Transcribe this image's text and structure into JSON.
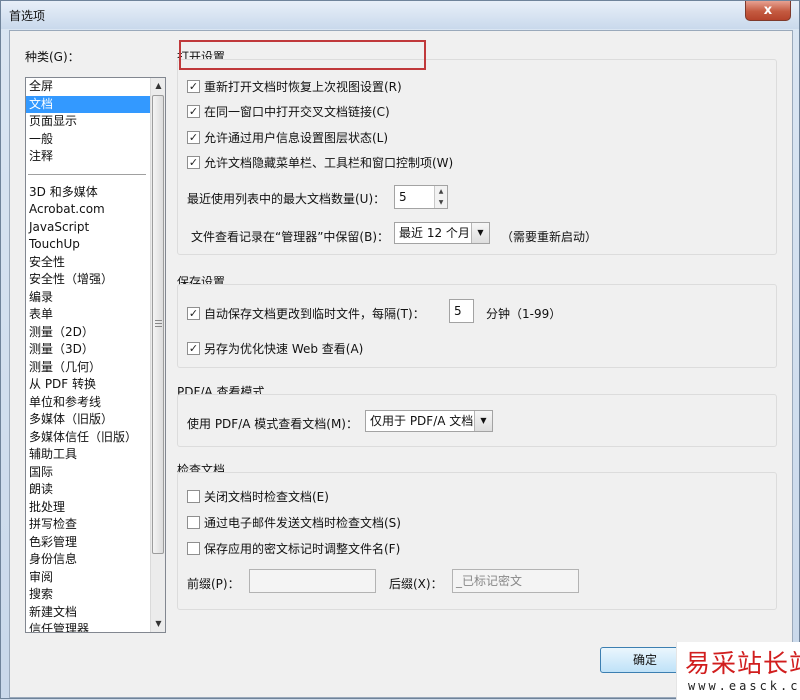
{
  "window": {
    "title": "首选项",
    "close_symbol": "x"
  },
  "sidebar": {
    "label": "种类(G)：",
    "group1": [
      {
        "label": "全屏",
        "selected": false
      },
      {
        "label": "文档",
        "selected": true
      },
      {
        "label": "页面显示",
        "selected": false
      },
      {
        "label": "一般",
        "selected": false
      },
      {
        "label": "注释",
        "selected": false
      }
    ],
    "group2": [
      "3D 和多媒体",
      "Acrobat.com",
      "JavaScript",
      "TouchUp",
      "安全性",
      "安全性（增强）",
      "编录",
      "表单",
      "测量（2D）",
      "测量（3D）",
      "测量（几何）",
      "从 PDF 转换",
      "单位和参考线",
      "多媒体（旧版）",
      "多媒体信任（旧版）",
      "辅助工具",
      "国际",
      "朗读",
      "批处理",
      "拼写检查",
      "色彩管理",
      "身份信息",
      "审阅",
      "搜索",
      "新建文档",
      "信任管理器"
    ]
  },
  "open_settings": {
    "title": "打开设置",
    "options": [
      {
        "label": "重新打开文档时恢复上次视图设置(R)",
        "checked": true
      },
      {
        "label": "在同一窗口中打开交叉文档链接(C)",
        "checked": true
      },
      {
        "label": "允许通过用户信息设置图层状态(L)",
        "checked": true
      },
      {
        "label": "允许文档隐藏菜单栏、工具栏和窗口控制项(W)",
        "checked": true
      }
    ],
    "max_recent_label": "最近使用列表中的最大文档数量(U)：",
    "max_recent_value": "5",
    "history_label": "文件查看记录在“管理器”中保留(B)：",
    "history_value": "最近 12 个月",
    "history_note": "（需要重新启动）"
  },
  "save_settings": {
    "title": "保存设置",
    "autosave_label": "自动保存文档更改到临时文件，每隔(T)：",
    "autosave_checked": true,
    "autosave_value": "5",
    "autosave_unit": "分钟（1-99）",
    "web_label": "另存为优化快速 Web 查看(A)",
    "web_checked": true
  },
  "pdfa": {
    "title": "PDF/A 查看模式",
    "mode_label": "使用 PDF/A 模式查看文档(M)：",
    "mode_value": "仅用于 PDF/A 文档"
  },
  "check_doc": {
    "title": "检查文档",
    "options": [
      {
        "label": "关闭文档时检查文档(E)",
        "checked": false
      },
      {
        "label": "通过电子邮件发送文档时检查文档(S)",
        "checked": false
      },
      {
        "label": "保存应用的密文标记时调整文件名(F)",
        "checked": false
      }
    ],
    "prefix_label": "前缀(P)：",
    "prefix_value": "",
    "suffix_label": "后缀(X)：",
    "suffix_value": "_已标记密文"
  },
  "buttons": {
    "ok": "确定"
  },
  "watermark": {
    "title": "易采站长站",
    "url": "www.easck.com"
  }
}
